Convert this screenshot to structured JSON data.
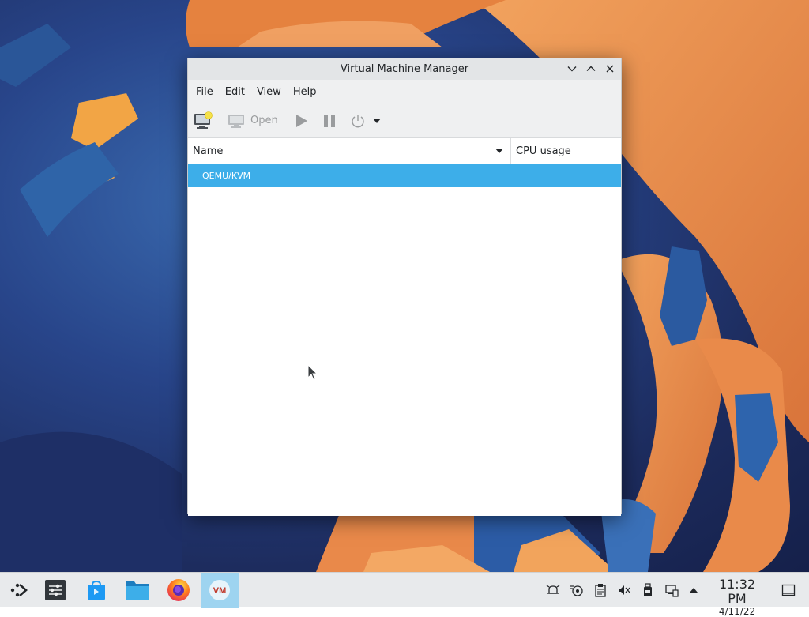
{
  "window": {
    "title": "Virtual Machine Manager"
  },
  "menubar": {
    "items": [
      "File",
      "Edit",
      "View",
      "Help"
    ]
  },
  "toolbar": {
    "open_label": "Open"
  },
  "list": {
    "columns": [
      "Name",
      "CPU usage"
    ],
    "rows": [
      {
        "name": "QEMU/KVM",
        "selected": true
      }
    ]
  },
  "taskbar": {
    "apps": [
      "application-launcher-icon",
      "system-settings-icon",
      "discover-icon",
      "file-manager-icon",
      "firefox-icon",
      "virt-manager-icon"
    ],
    "active_app": "virt-manager-icon"
  },
  "clock": {
    "time": "11:32 PM",
    "date": "4/11/22"
  },
  "colors": {
    "selection": "#3daee9",
    "accent_orange": "#e8894a",
    "desktop_blue": "#28458a"
  }
}
